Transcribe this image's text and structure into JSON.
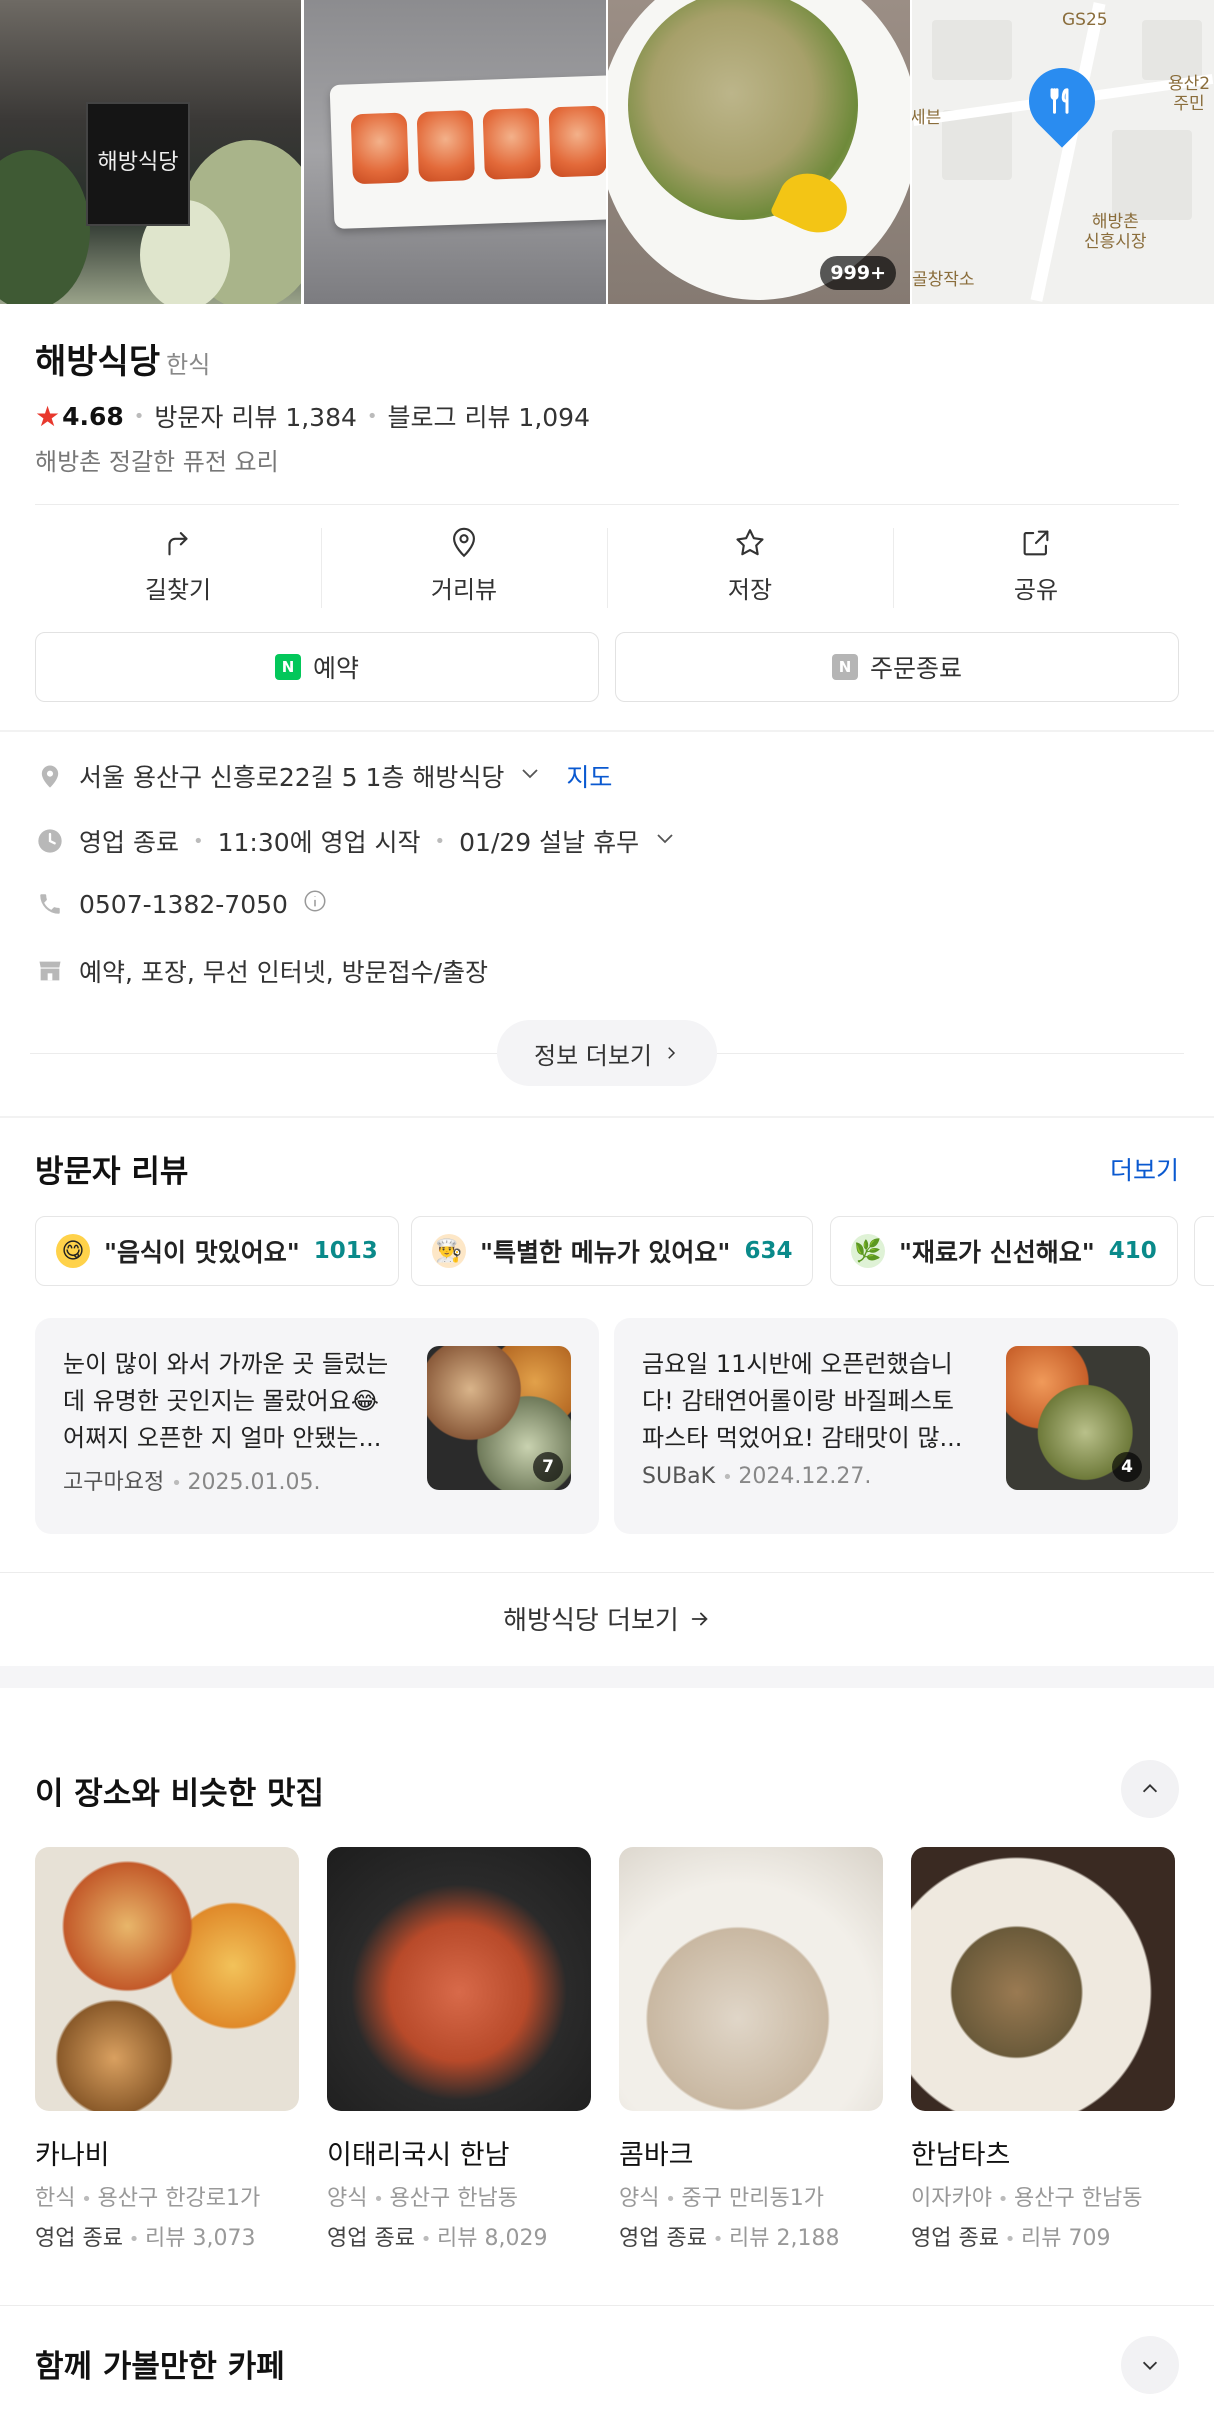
{
  "photos": {
    "sign_text": "해방식당",
    "photo_count": "999+",
    "map_labels": {
      "gs25": "GS25",
      "market": "해방촌\n신흥시장",
      "district": "용산2\n주민",
      "side_left": "세븐",
      "bottom": "골창작소"
    }
  },
  "place": {
    "name": "해방식당",
    "category": "한식",
    "rating": "4.68",
    "visitor_reviews": "방문자 리뷰 1,384",
    "blog_reviews": "블로그 리뷰 1,094",
    "description": "해방촌 정갈한 퓨전 요리"
  },
  "actions": [
    {
      "label": "길찾기",
      "icon": "directions-icon"
    },
    {
      "label": "거리뷰",
      "icon": "street-view-icon"
    },
    {
      "label": "저장",
      "icon": "star-icon"
    },
    {
      "label": "공유",
      "icon": "share-icon"
    }
  ],
  "buttons": {
    "reserve": "예약",
    "order": "주문종료",
    "naver_badge": "N"
  },
  "info": {
    "address": "서울 용산구 신흥로22길 5 1층 해방식당",
    "map_link": "지도",
    "status": "영업 종료",
    "open_time": "11:30에 영업 시작",
    "holiday": "01/29 설날 휴무",
    "phone": "0507-1382-7050",
    "amenities": "예약, 포장, 무선 인터넷, 방문접수/출장",
    "more": "정보 더보기"
  },
  "reviews": {
    "title": "방문자 리뷰",
    "more": "더보기",
    "chips": [
      {
        "text": "\"음식이 맛있어요\"",
        "count": "1013",
        "emoji": "😋"
      },
      {
        "text": "\"특별한 메뉴가 있어요\"",
        "count": "634",
        "emoji": "👨‍🍳"
      },
      {
        "text": "\"재료가 신선해요\"",
        "count": "410",
        "emoji": "🌿"
      }
    ],
    "cards": [
      {
        "text": "눈이 많이 와서 가까운 곳 들렀는데 유명한 곳인지는 몰랐어요😂 어쩌지 오픈한 지 얼마 안됐는...",
        "author": "고구마요정",
        "date": "2025.01.05.",
        "photo_count": "7"
      },
      {
        "text": "금요일 11시반에 오픈런했습니다! 감태연어롤이랑 바질페스토 파스타 먹었어요! 감태맛이 많...",
        "author": "SUBaK",
        "date": "2024.12.27.",
        "photo_count": "4"
      }
    ],
    "footer_more": "해방식당 더보기"
  },
  "similar": {
    "title": "이 장소와 비슷한 맛집",
    "items": [
      {
        "name": "카나비",
        "category": "한식",
        "area": "용산구 한강로1가",
        "status": "영업 종료",
        "reviews": "리뷰 3,073"
      },
      {
        "name": "이태리국시 한남",
        "category": "양식",
        "area": "용산구 한남동",
        "status": "영업 종료",
        "reviews": "리뷰 8,029"
      },
      {
        "name": "콤바크",
        "category": "양식",
        "area": "중구 만리동1가",
        "status": "영업 종료",
        "reviews": "리뷰 2,188"
      },
      {
        "name": "한남타츠",
        "category": "이자카야",
        "area": "용산구 한남동",
        "status": "영업 종료",
        "reviews": "리뷰 709"
      }
    ]
  },
  "cafes": {
    "title": "함께 가볼만한 카페"
  },
  "colors": {
    "accent_blue": "#0a59d0",
    "star_red": "#e8382d",
    "count_teal": "#0a8a8a",
    "naver_green": "#03c75a",
    "pin_blue": "#2a8cf0"
  }
}
